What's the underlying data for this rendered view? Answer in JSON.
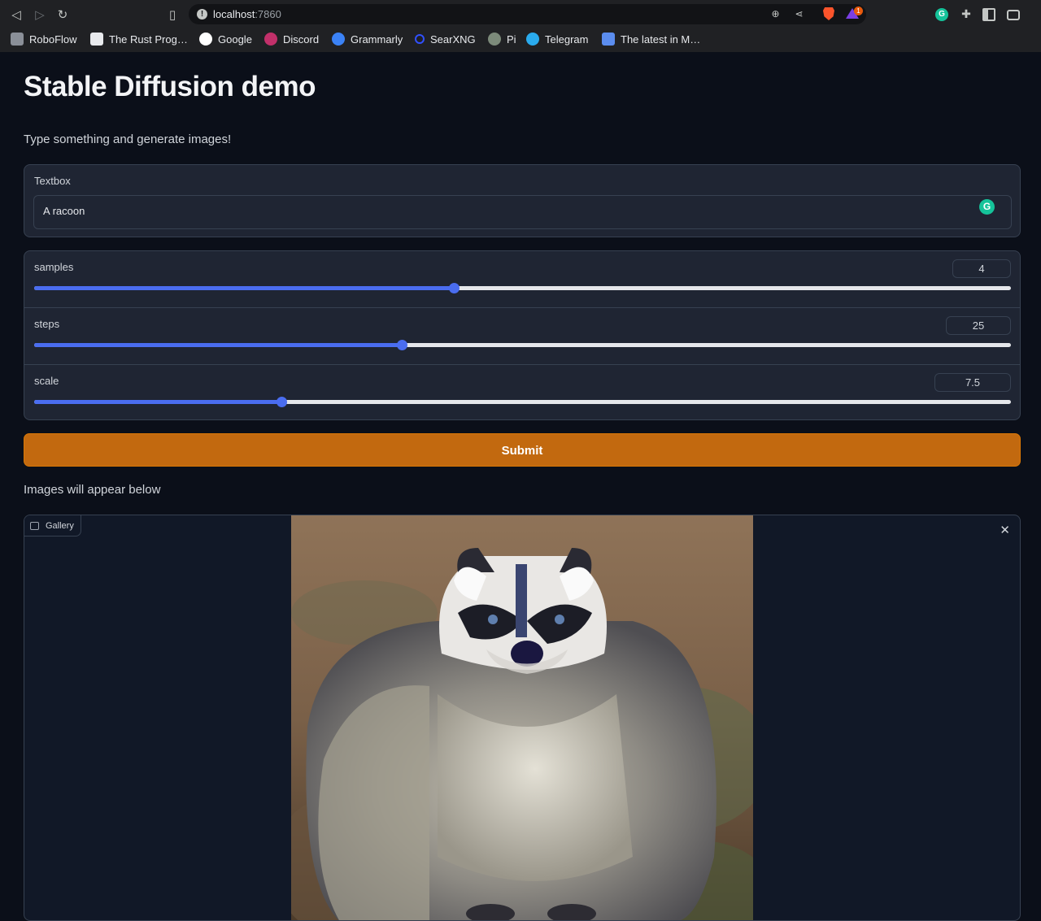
{
  "browser": {
    "url_host": "localhost",
    "url_port": ":7860",
    "alert_count": "1",
    "bookmarks": [
      {
        "label": "RoboFlow",
        "color": "#8a8f98"
      },
      {
        "label": "The Rust Prog…",
        "color": "#e8eaed"
      },
      {
        "label": "Google",
        "color": "#ffffff"
      },
      {
        "label": "Discord",
        "color": "#c2306a"
      },
      {
        "label": "Grammarly",
        "color": "#3b82f6"
      },
      {
        "label": "SearXNG",
        "color": "#3050ff"
      },
      {
        "label": "Pi",
        "color": "#7c8a7a"
      },
      {
        "label": "Telegram",
        "color": "#2aabee"
      },
      {
        "label": "The latest in M…",
        "color": "#5b8def"
      }
    ]
  },
  "app": {
    "title": "Stable Diffusion demo",
    "subtitle": "Type something and generate images!",
    "textbox": {
      "label": "Textbox",
      "value": "A racoon"
    },
    "sliders": [
      {
        "label": "samples",
        "value": "4",
        "fraction": 0.43
      },
      {
        "label": "steps",
        "value": "25",
        "fraction": 0.376
      },
      {
        "label": "scale",
        "value": "7.5",
        "fraction": 0.253
      }
    ],
    "submit_label": "Submit",
    "images_note": "Images will appear below",
    "gallery": {
      "label": "Gallery"
    }
  }
}
